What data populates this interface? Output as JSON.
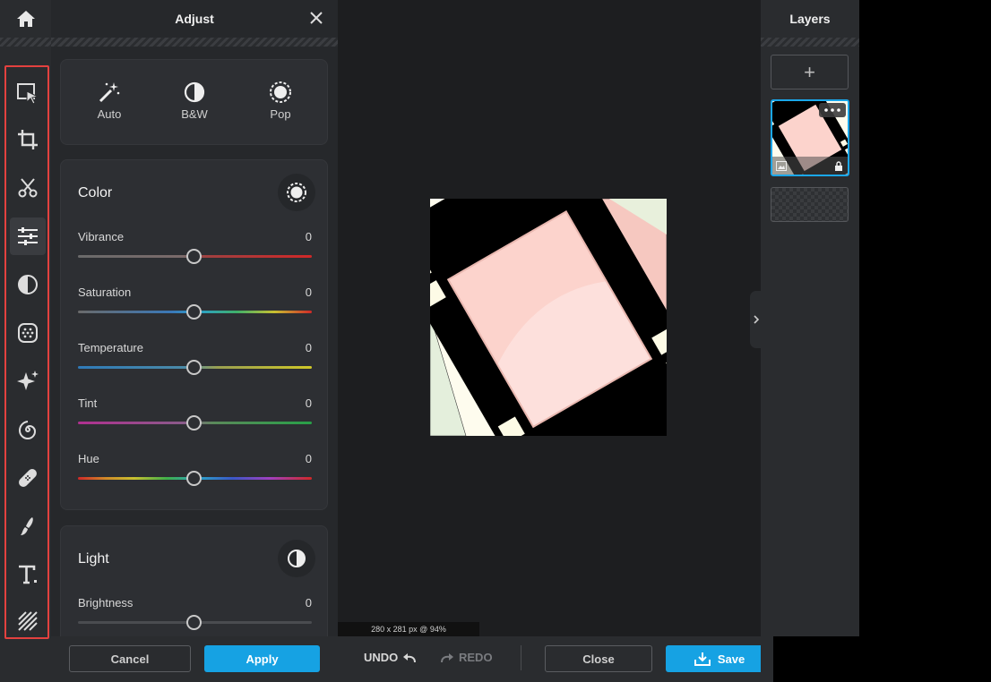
{
  "panel": {
    "title": "Adjust",
    "presets": [
      {
        "label": "Auto",
        "icon": "magic-wand-icon"
      },
      {
        "label": "B&W",
        "icon": "contrast-half-circle-icon"
      },
      {
        "label": "Pop",
        "icon": "sun-burst-icon"
      }
    ],
    "color": {
      "title": "Color",
      "sliders": [
        {
          "label": "Vibrance",
          "value": "0"
        },
        {
          "label": "Saturation",
          "value": "0"
        },
        {
          "label": "Temperature",
          "value": "0"
        },
        {
          "label": "Tint",
          "value": "0"
        },
        {
          "label": "Hue",
          "value": "0"
        }
      ]
    },
    "light": {
      "title": "Light",
      "sliders": [
        {
          "label": "Brightness",
          "value": "0"
        }
      ]
    },
    "cancel_label": "Cancel",
    "apply_label": "Apply"
  },
  "toolbar": {
    "tools": [
      "select-icon",
      "crop-icon",
      "cutout-scissors-icon",
      "adjust-sliders-icon",
      "effects-icon",
      "filters-dots-icon",
      "ai-sparkle-icon",
      "liquify-swirl-icon",
      "heal-bandage-icon",
      "brush-icon",
      "text-icon",
      "texture-stripes-icon"
    ],
    "active_tool": "adjust-sliders-icon"
  },
  "canvas": {
    "info": "280 x 281 px @ 94%"
  },
  "bottom": {
    "undo_label": "UNDO",
    "redo_label": "REDO",
    "close_label": "Close",
    "save_label": "Save"
  },
  "layers": {
    "title": "Layers",
    "add_symbol": "+"
  },
  "colors": {
    "accent": "#16a2e3",
    "highlight_border": "#e3413f",
    "film_pink": "#fdd6d1",
    "film_black": "#000000"
  }
}
